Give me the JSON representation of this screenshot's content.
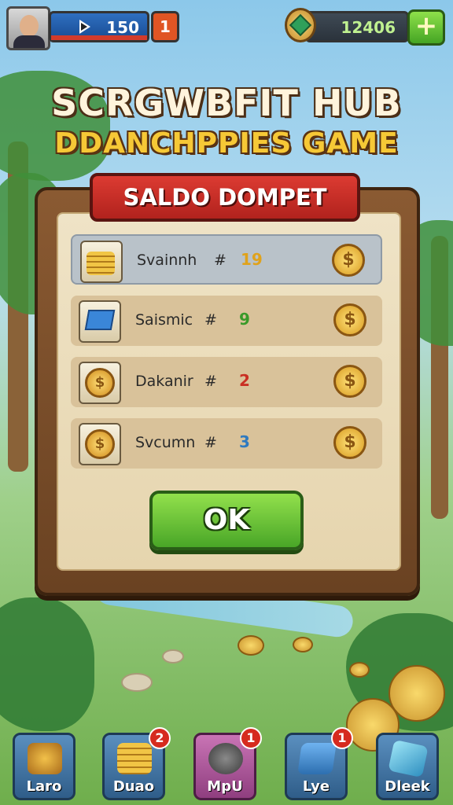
{
  "top_bar": {
    "level_value": "150",
    "lives_value": "1",
    "gems_value": "12406",
    "add_label": "+"
  },
  "title": {
    "line1": "SCRGWBFIT HUB",
    "line2": "DDANCHPPIES GAME"
  },
  "wallet_modal": {
    "header": "SALDO DOMPET",
    "rows": [
      {
        "label": "Svainnh",
        "amount": "19",
        "amount_color": "#e0a21b",
        "icon": "coin-stack-icon"
      },
      {
        "label": "Saismic",
        "amount": "9",
        "amount_color": "#3a9a2a",
        "icon": "computer-icon"
      },
      {
        "label": "Dakanir",
        "amount": "2",
        "amount_color": "#c92f23",
        "icon": "dollar-coin-icon"
      },
      {
        "label": "Svcumn",
        "amount": "3",
        "amount_color": "#2f7ac0",
        "icon": "dollar-coin-icon"
      }
    ],
    "hash_symbol": "#",
    "coin_symbol": "$",
    "ok_label": "OK"
  },
  "bottom_nav": [
    {
      "label": "Laro",
      "badge": "",
      "icon": "treasure-bowl-icon"
    },
    {
      "label": "Duao",
      "badge": "2",
      "icon": "coin-stack-icon"
    },
    {
      "label": "MpU",
      "badge": "1",
      "icon": "raccoon-icon"
    },
    {
      "label": "Lye",
      "badge": "1",
      "icon": "laptop-icon"
    },
    {
      "label": "Dleek",
      "badge": "",
      "icon": "crystal-icon"
    }
  ],
  "colors": {
    "accent_red": "#c82a22",
    "accent_green": "#5bb52f",
    "wood": "#7a4e2a"
  }
}
